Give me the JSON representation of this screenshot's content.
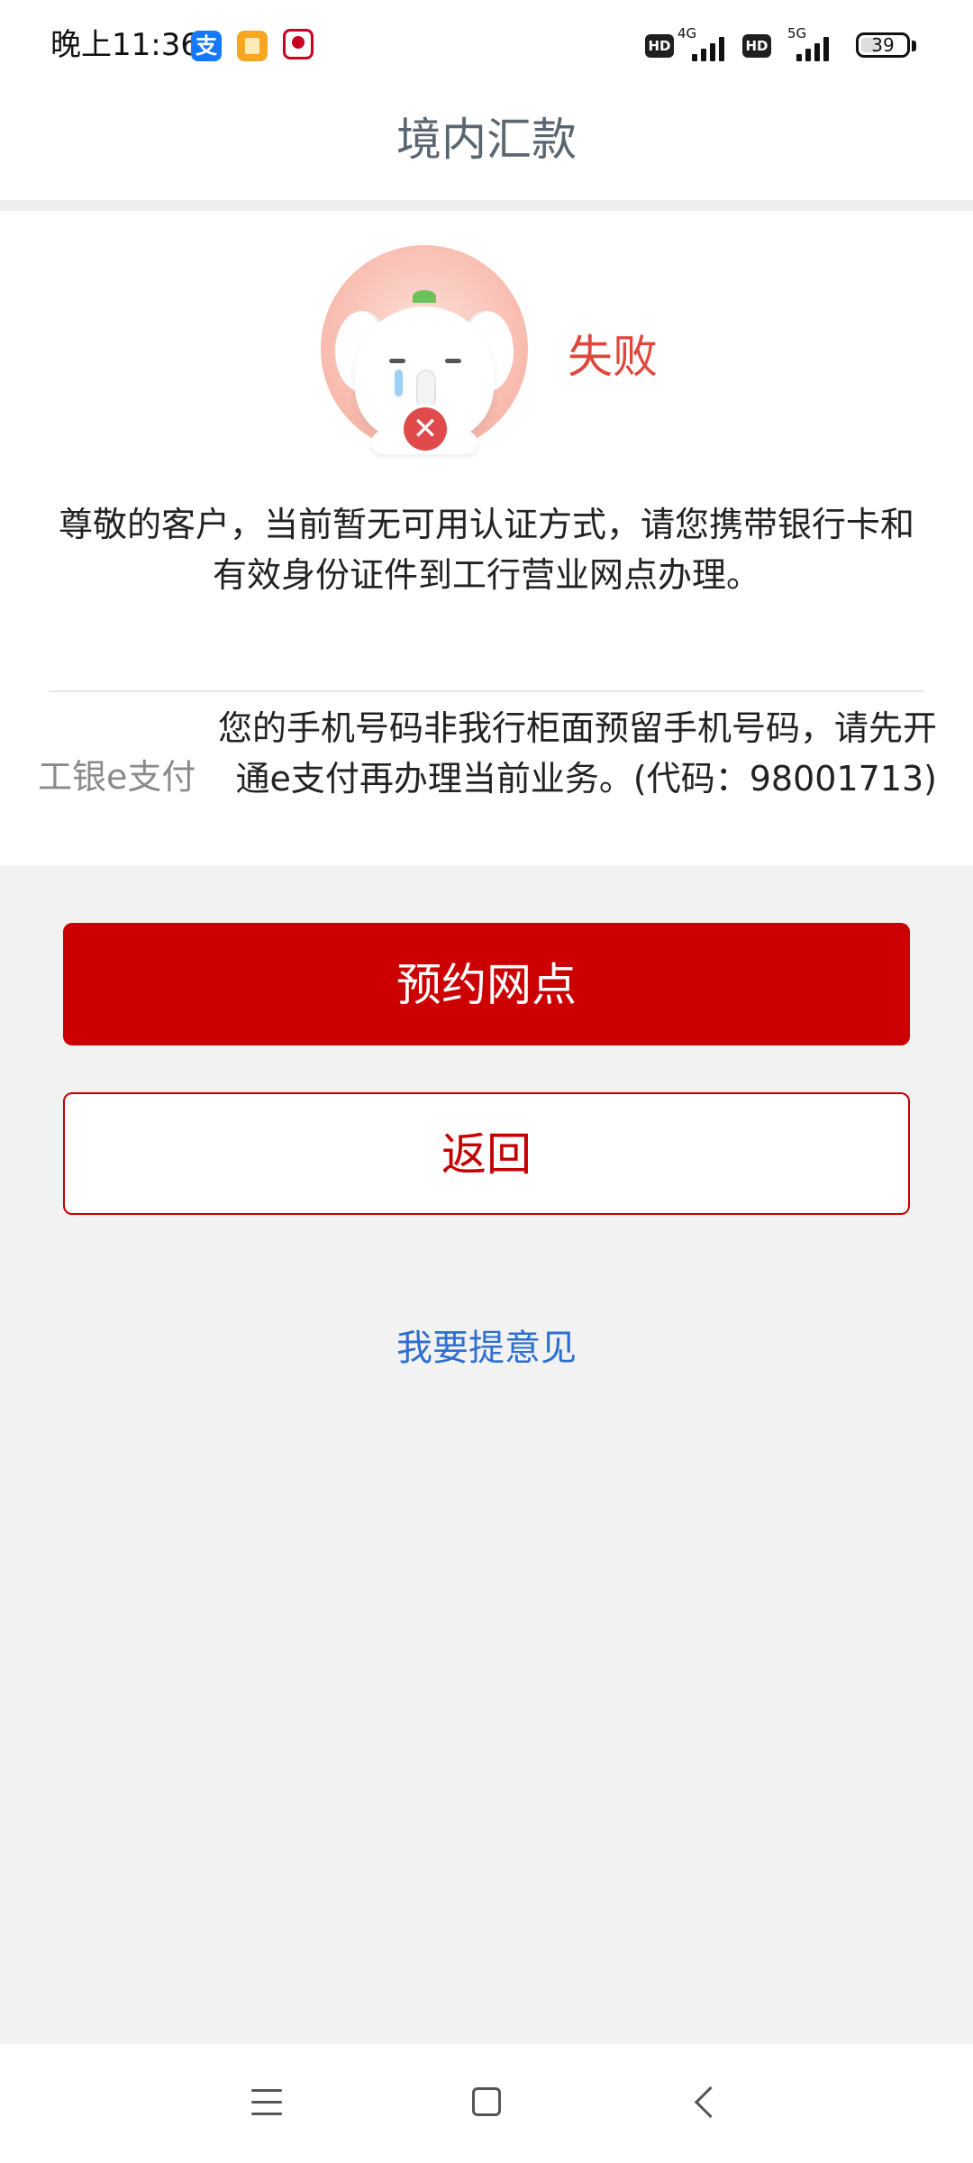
{
  "status_bar": {
    "time": "晚上11:36",
    "apps": [
      "alipay-icon",
      "notes-icon",
      "game-icon"
    ],
    "alipay_glyph": "支",
    "hd_badge": "HD",
    "network_1": "4G",
    "network_2": "5G",
    "battery": "39"
  },
  "header": {
    "title": "境内汇款"
  },
  "result": {
    "status": "失败",
    "message": "尊敬的客户，当前暂无可用认证方式，请您携带银行卡和有效身份证件到工行营业网点办理。",
    "detail_label": "工银e支付",
    "detail_value": "您的手机号码非我行柜面预留手机号码，请先开通e支付再办理当前业务。(代码：98001713)"
  },
  "actions": {
    "primary_label": "预约网点",
    "secondary_label": "返回",
    "feedback_label": "我要提意见"
  },
  "colors": {
    "brand_red": "#cc0000",
    "failure_red": "#e0463c",
    "link_blue": "#2f6fcf"
  }
}
